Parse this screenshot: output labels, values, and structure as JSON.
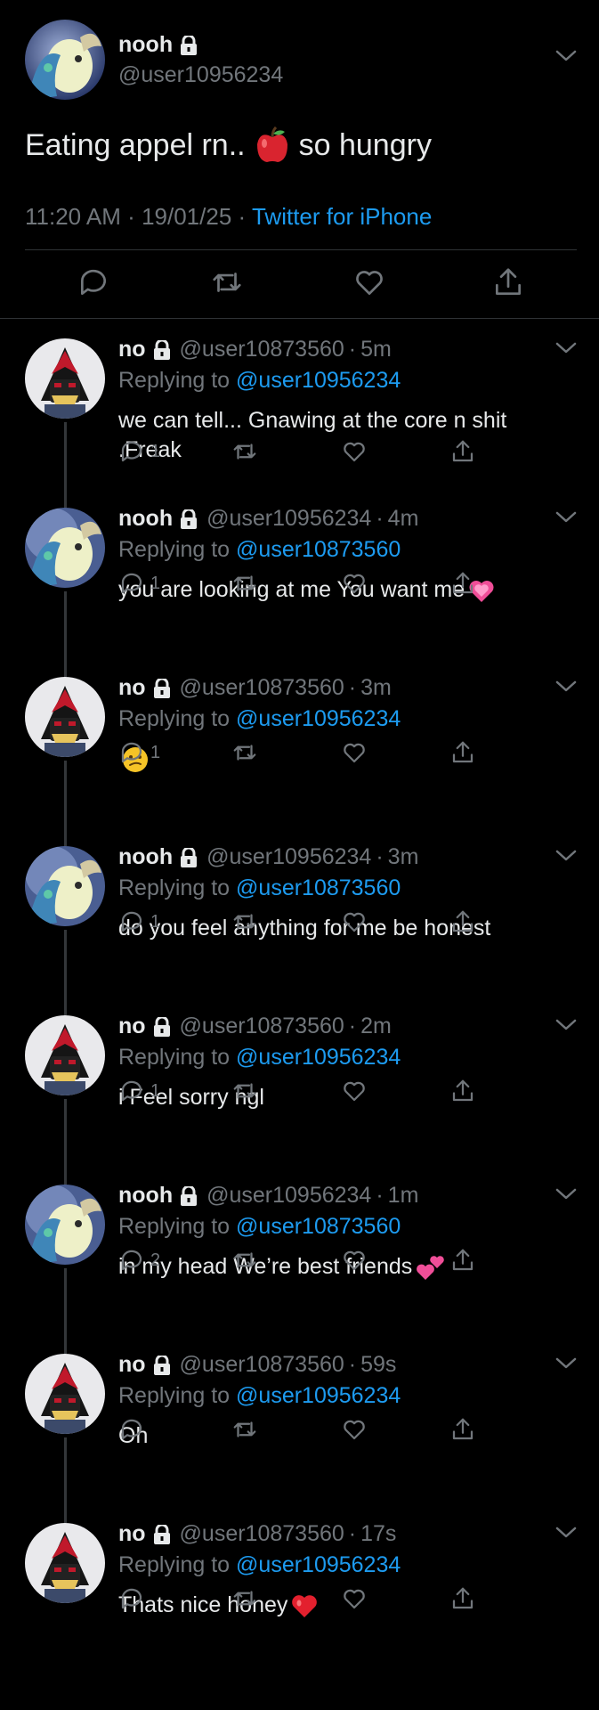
{
  "colors": {
    "background": "#000000",
    "text": "#e7e9ea",
    "muted": "#71767b",
    "link": "#1d9bf0",
    "divider": "#2f3336"
  },
  "main_tweet": {
    "name": "nooh",
    "handle": "@user10956234",
    "text_before": "Eating appel rn..",
    "text_after": "so hungry",
    "emoji": "red-apple-icon",
    "time": "11:20 AM",
    "date": "19/01/25",
    "source": "Twitter for iPhone",
    "separator": "·"
  },
  "replying_to_label": "Replying to",
  "replies": [
    {
      "name": "no",
      "handle": "@user10873560",
      "time": "5m",
      "replying_to": "@user10956234",
      "text": "we can tell... Gnawing at the core n shit .Freak",
      "reply_count": "1",
      "avatar": "shadow"
    },
    {
      "name": "nooh",
      "handle": "@user10956234",
      "time": "4m",
      "replying_to": "@user10873560",
      "text": "you are looking at me You want me",
      "emoji": "growing-heart-icon",
      "reply_count": "1",
      "avatar": "blue"
    },
    {
      "name": "no",
      "handle": "@user10873560",
      "time": "3m",
      "replying_to": "@user10956234",
      "text": "",
      "emoji": "confused-face-icon",
      "reply_count": "1",
      "avatar": "shadow"
    },
    {
      "name": "nooh",
      "handle": "@user10956234",
      "time": "3m",
      "replying_to": "@user10873560",
      "text": "do you feel anything for me be honest",
      "reply_count": "1",
      "avatar": "blue"
    },
    {
      "name": "no",
      "handle": "@user10873560",
      "time": "2m",
      "replying_to": "@user10956234",
      "text": "i Feel sorry ngl",
      "reply_count": "1",
      "avatar": "shadow"
    },
    {
      "name": "nooh",
      "handle": "@user10956234",
      "time": "1m",
      "replying_to": "@user10873560",
      "text": "in my head We’re best friends",
      "emoji": "two-hearts-icon",
      "reply_count": "2",
      "avatar": "blue"
    },
    {
      "name": "no",
      "handle": "@user10873560",
      "time": "59s",
      "replying_to": "@user10956234",
      "text": "Oh",
      "reply_count": "",
      "avatar": "shadow"
    },
    {
      "name": "no",
      "handle": "@user10873560",
      "time": "17s",
      "replying_to": "@user10956234",
      "text": "Thats nice honey",
      "emoji": "red-heart-icon",
      "reply_count": "",
      "avatar": "shadow"
    }
  ]
}
